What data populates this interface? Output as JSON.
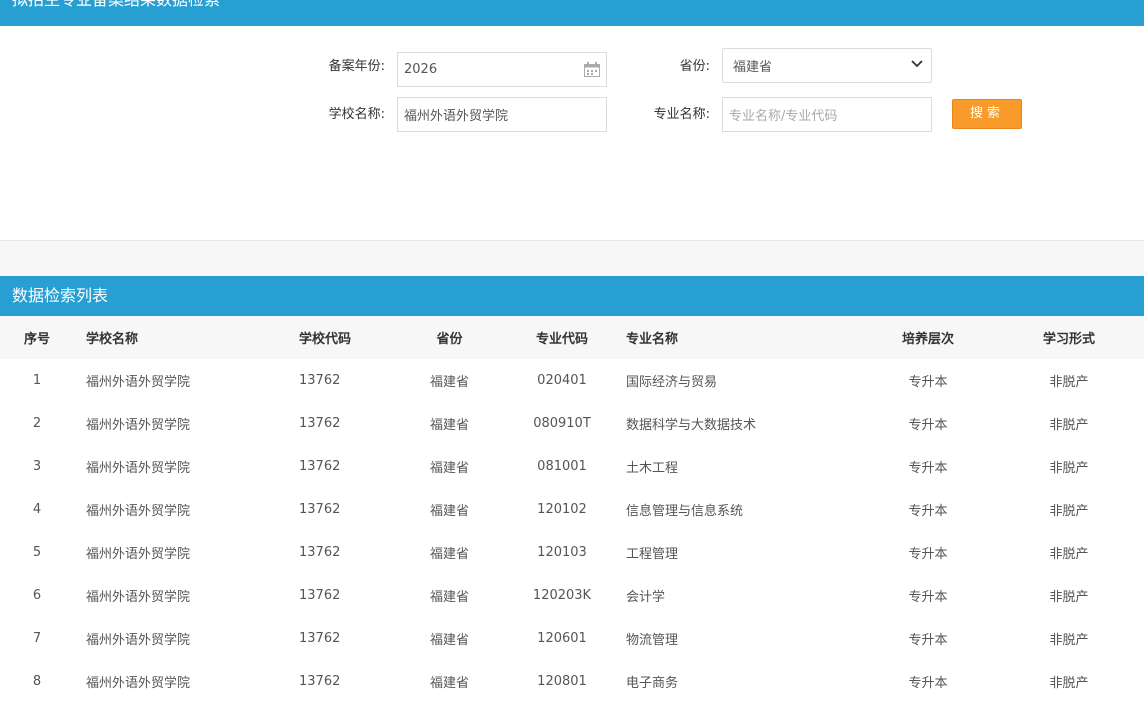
{
  "header": {
    "title": "拟招生专业备案结果数据检索"
  },
  "form": {
    "year_label": "备案年份:",
    "year_value": "2026",
    "province_label": "省份:",
    "province_value": "福建省",
    "school_label": "学校名称:",
    "school_value": "福州外语外贸学院",
    "major_label": "专业名称:",
    "major_placeholder": "专业名称/专业代码",
    "search_label": "搜索"
  },
  "list": {
    "title": "数据检索列表",
    "columns": [
      "序号",
      "学校名称",
      "学校代码",
      "省份",
      "专业代码",
      "专业名称",
      "培养层次",
      "学习形式"
    ],
    "rows": [
      [
        "1",
        "福州外语外贸学院",
        "13762",
        "福建省",
        "020401",
        "国际经济与贸易",
        "专升本",
        "非脱产"
      ],
      [
        "2",
        "福州外语外贸学院",
        "13762",
        "福建省",
        "080910T",
        "数据科学与大数据技术",
        "专升本",
        "非脱产"
      ],
      [
        "3",
        "福州外语外贸学院",
        "13762",
        "福建省",
        "081001",
        "土木工程",
        "专升本",
        "非脱产"
      ],
      [
        "4",
        "福州外语外贸学院",
        "13762",
        "福建省",
        "120102",
        "信息管理与信息系统",
        "专升本",
        "非脱产"
      ],
      [
        "5",
        "福州外语外贸学院",
        "13762",
        "福建省",
        "120103",
        "工程管理",
        "专升本",
        "非脱产"
      ],
      [
        "6",
        "福州外语外贸学院",
        "13762",
        "福建省",
        "120203K",
        "会计学",
        "专升本",
        "非脱产"
      ],
      [
        "7",
        "福州外语外贸学院",
        "13762",
        "福建省",
        "120601",
        "物流管理",
        "专升本",
        "非脱产"
      ],
      [
        "8",
        "福州外语外贸学院",
        "13762",
        "福建省",
        "120801",
        "电子商务",
        "专升本",
        "非脱产"
      ]
    ]
  },
  "icons": {
    "calendar": "calendar-icon",
    "dropdown": "chevron-down-icon"
  },
  "colors": {
    "header_bar": "#279fd3",
    "search_button": "#f99b2a"
  }
}
